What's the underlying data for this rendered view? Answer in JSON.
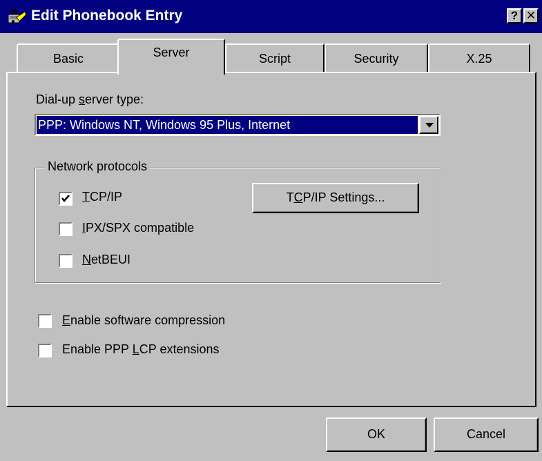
{
  "window": {
    "title": "Edit Phonebook Entry",
    "help_glyph": "?",
    "close_glyph": "✕"
  },
  "tabs": [
    {
      "label": "Basic",
      "selected": false
    },
    {
      "label": "Server",
      "selected": true
    },
    {
      "label": "Script",
      "selected": false
    },
    {
      "label": "Security",
      "selected": false
    },
    {
      "label": "X.25",
      "selected": false
    }
  ],
  "server": {
    "type_label_pre": "Dial-up ",
    "type_label_key": "s",
    "type_label_post": "erver type:",
    "type_value": "PPP: Windows NT, Windows 95 Plus, Internet",
    "protocols_legend": "Network protocols",
    "protocols": [
      {
        "key": "T",
        "rest": "CP/IP",
        "checked": true
      },
      {
        "key": "I",
        "rest": "PX/SPX compatible",
        "checked": false
      },
      {
        "key": "N",
        "rest": "etBEUI",
        "checked": false
      }
    ],
    "tcpip_settings": {
      "pre": "T",
      "key": "C",
      "post": "P/IP Settings..."
    },
    "options": [
      {
        "pre": "",
        "key": "E",
        "post": "nable software compression",
        "checked": false
      },
      {
        "pre": "Enable PPP ",
        "key": "L",
        "post": "CP extensions",
        "checked": false
      }
    ]
  },
  "buttons": {
    "ok": "OK",
    "cancel": "Cancel"
  },
  "colors": {
    "titlebar": "#000080",
    "face": "#c0c0c0",
    "selection": "#000080"
  }
}
